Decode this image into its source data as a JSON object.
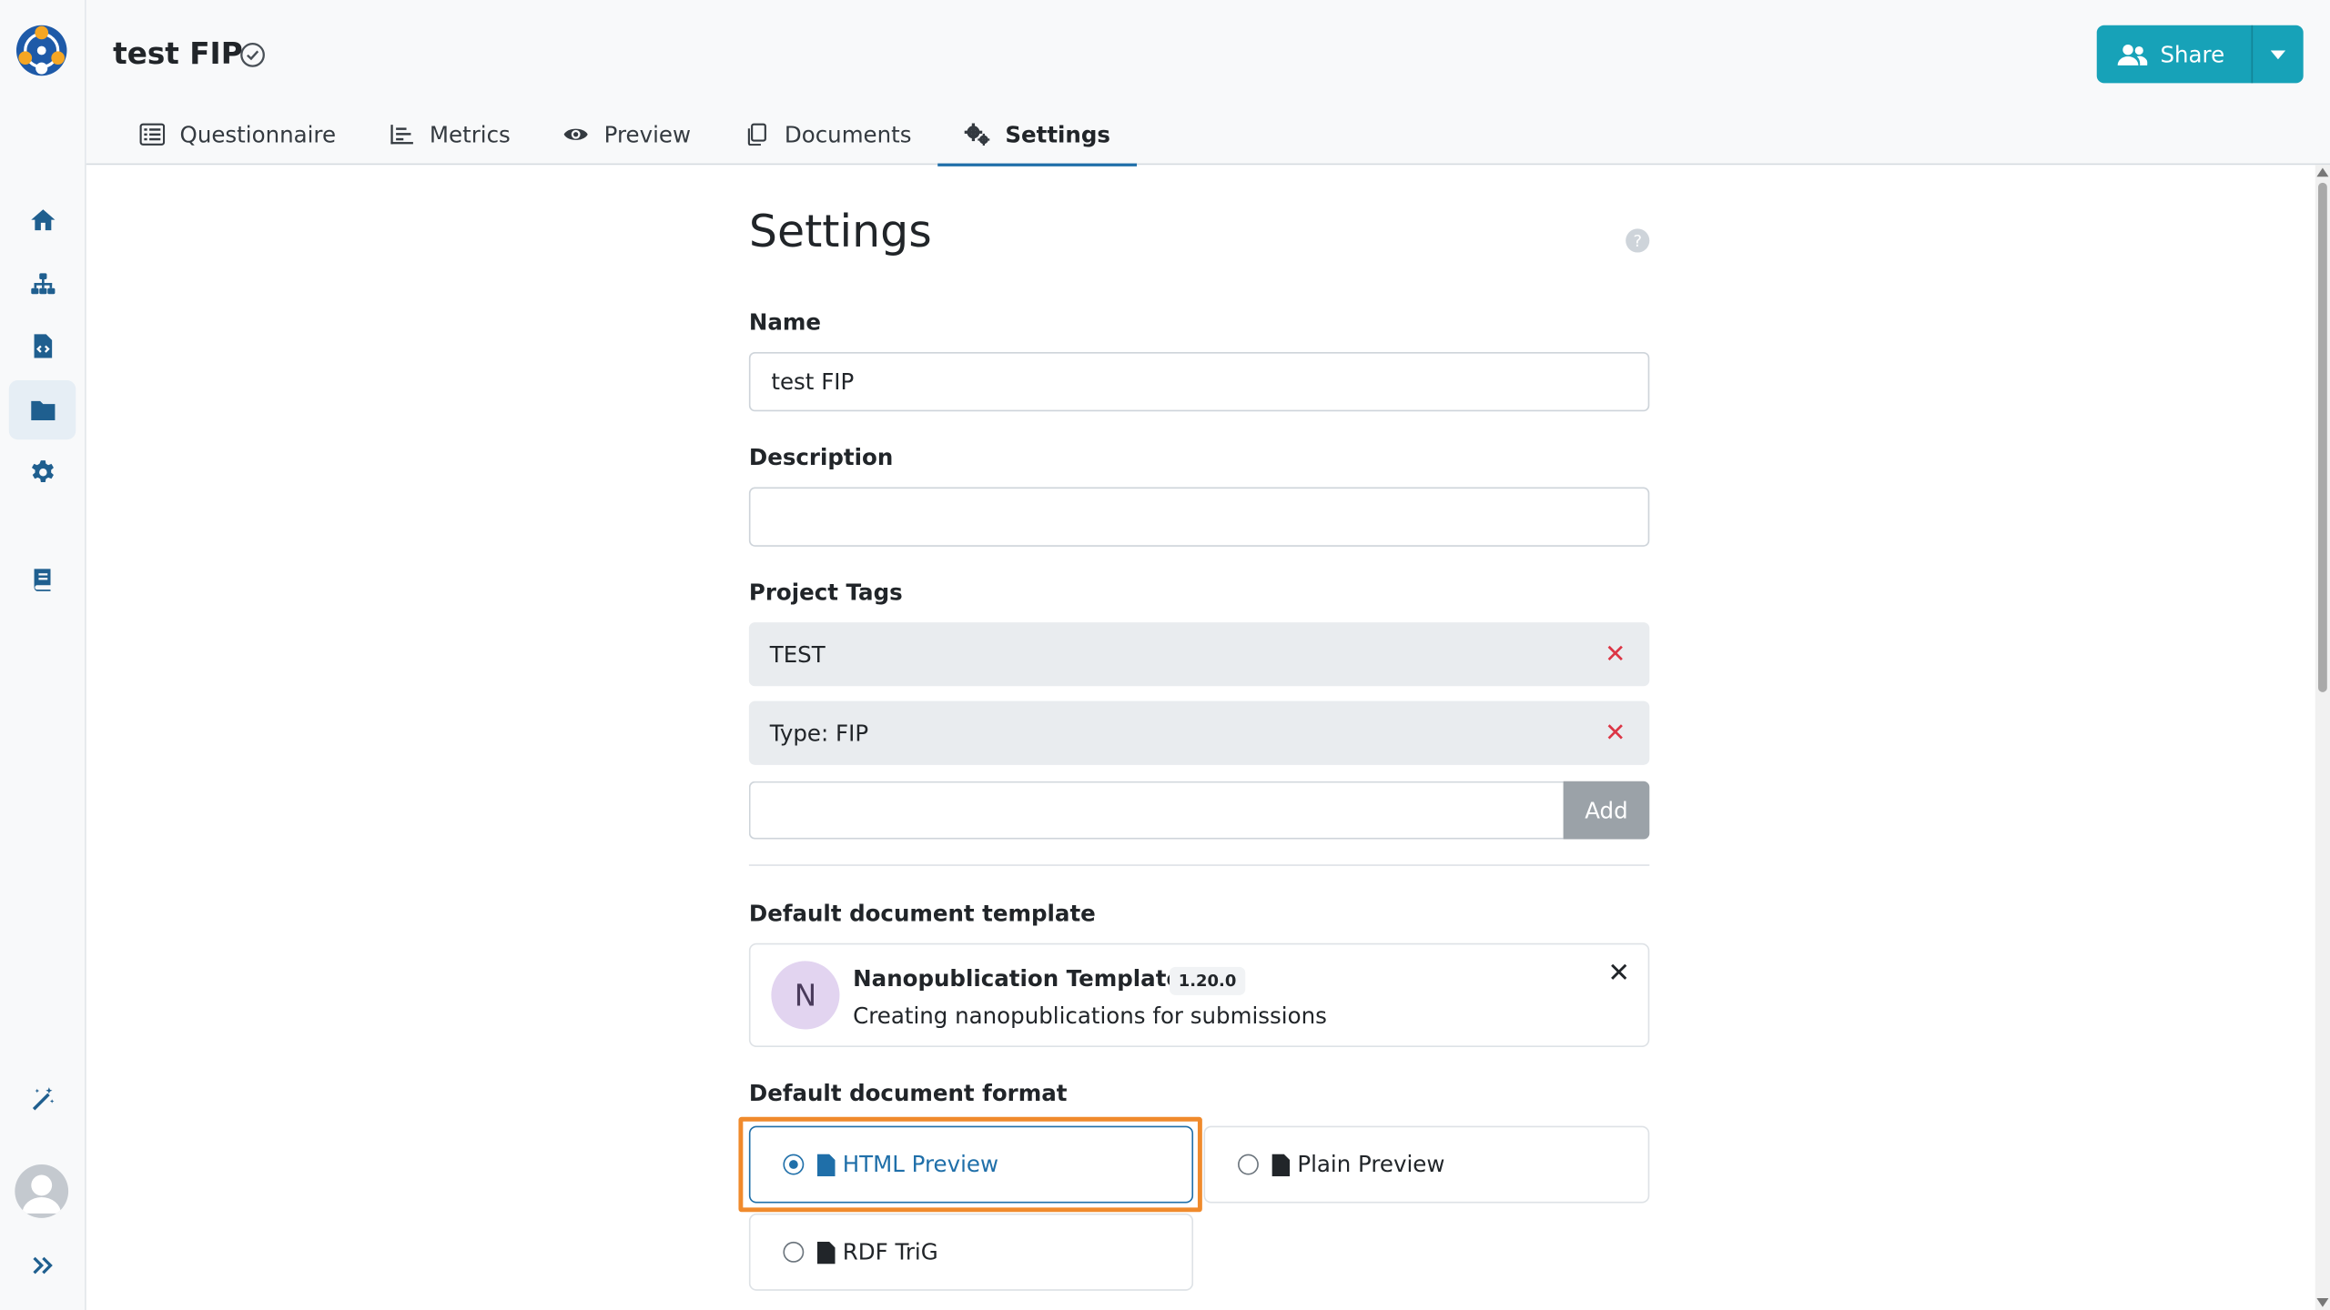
{
  "app": {
    "logo_name": "app-logo",
    "project_title": "test FIP",
    "share_label": "Share"
  },
  "tabs": [
    {
      "label": "Questionnaire",
      "icon": "list-icon"
    },
    {
      "label": "Metrics",
      "icon": "chart-icon"
    },
    {
      "label": "Preview",
      "icon": "eye-icon"
    },
    {
      "label": "Documents",
      "icon": "copy-icon"
    },
    {
      "label": "Settings",
      "icon": "cogs-icon",
      "active": true
    }
  ],
  "sidebar": {
    "items": [
      {
        "icon": "home-icon"
      },
      {
        "icon": "sitemap-icon"
      },
      {
        "icon": "file-code-icon"
      },
      {
        "icon": "folder-icon",
        "active": true
      },
      {
        "icon": "gear-icon"
      },
      {
        "icon": "book-icon"
      },
      {
        "icon": "magic-wand-icon"
      },
      {
        "icon": "expand-icon"
      }
    ]
  },
  "settings": {
    "title": "Settings",
    "name_label": "Name",
    "name_value": "test FIP",
    "description_label": "Description",
    "description_value": "",
    "tags_label": "Project Tags",
    "tags": [
      "TEST",
      "Type: FIP"
    ],
    "add_tag_label": "Add",
    "template_label": "Default document template",
    "template": {
      "initial": "N",
      "name": "Nanopublication Template",
      "version": "1.20.0",
      "description": "Creating nanopublications for submissions"
    },
    "format_label": "Default document format",
    "formats": [
      {
        "label": "HTML Preview",
        "selected": true
      },
      {
        "label": "Plain Preview",
        "selected": false
      },
      {
        "label": "RDF TriG",
        "selected": false
      }
    ]
  },
  "colors": {
    "accent": "#1f6fa9",
    "share": "#17a2b8",
    "highlight": "#f08a2c",
    "danger": "#dc3545"
  }
}
